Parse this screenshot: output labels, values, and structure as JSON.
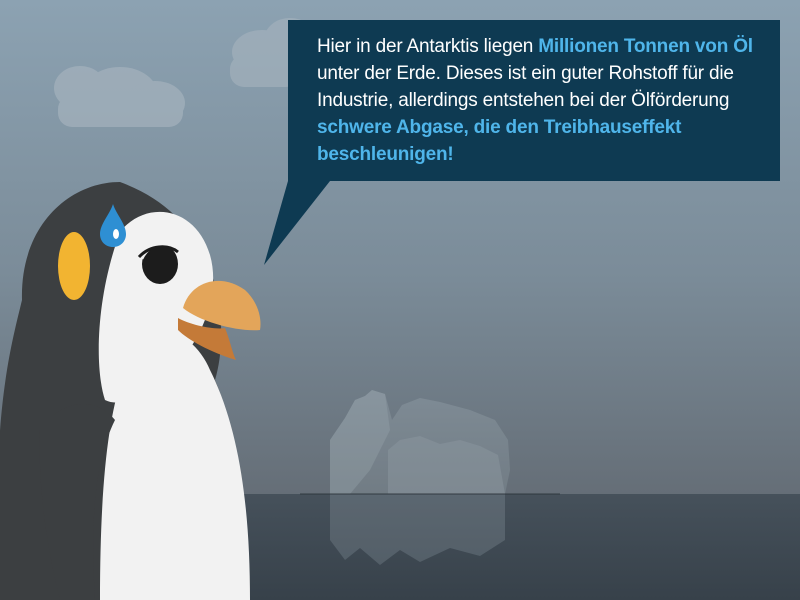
{
  "dialog": {
    "part1": "Hier in der Antarktis liegen ",
    "highlight1": "Millionen Tonnen von Öl",
    "part2": " unter der Erde. Dieses ist ein guter Rohstoff für die Industrie, allerdings entstehen bei der Ölförderung ",
    "highlight2": "schwere Abgase, die den Treibhauseffekt beschleunigen!"
  },
  "colors": {
    "sky_top": "#8ca2b2",
    "sky_bottom": "#69737c",
    "sea": "#3d4750",
    "bubble": "#0e3a52",
    "highlight": "#4fb5ea",
    "penguin_body": "#3c3f41",
    "penguin_belly": "#f2f2f2",
    "beak_upper": "#e3a55a",
    "beak_lower": "#c47a38",
    "cheek": "#f2b431",
    "sweat_drop": "#2e8fd3"
  },
  "icons": {
    "character": "penguin-character",
    "sweat": "sweat-drop-icon",
    "background": "iceberg"
  }
}
